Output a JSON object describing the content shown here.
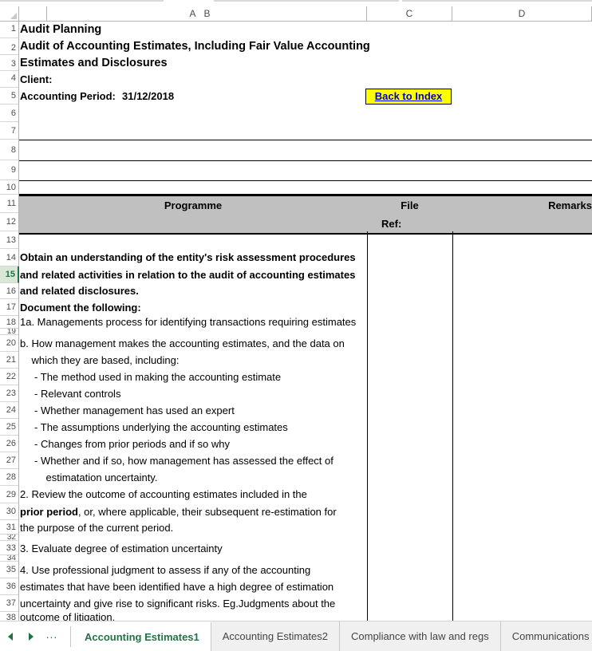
{
  "app": {
    "type": "spreadsheet",
    "columns": [
      "A",
      "B",
      "C",
      "D"
    ],
    "selected_row": 15,
    "accent_color": "#217346",
    "header_fill": "#c0c0c0",
    "hyperlink_fill": "#ffff00",
    "hyperlink_color": "#0000cc"
  },
  "row_numbers": [
    1,
    2,
    3,
    4,
    5,
    6,
    7,
    8,
    9,
    10,
    11,
    12,
    13,
    14,
    15,
    16,
    17,
    18,
    19,
    20,
    21,
    22,
    23,
    24,
    25,
    26,
    27,
    28,
    29,
    30,
    31,
    32,
    33,
    34,
    35,
    36,
    37,
    38
  ],
  "header_block": {
    "line1": "Audit Planning",
    "line2": "Audit of Accounting Estimates, Including Fair Value Accounting",
    "line3": "Estimates and Disclosures",
    "client_label": "Client:",
    "client_value": "",
    "period_label": "Accounting Period:",
    "period_value": "31/12/2018",
    "back_to_index": "Back to Index"
  },
  "table_header": {
    "programme": "Programme",
    "file": "File",
    "ref": "Ref:",
    "remarks": "Remarks"
  },
  "programme_lines": [
    {
      "row": 14,
      "text": "Obtain an understanding of the entity's risk assessment procedures",
      "bold": true
    },
    {
      "row": 15,
      "text": "and related activities in relation to the audit of accounting estimates",
      "bold": true
    },
    {
      "row": 16,
      "text": "and related disclosures.",
      "bold": true
    },
    {
      "row": 17,
      "text": "Document the following:",
      "bold": true
    },
    {
      "row": 18,
      "text": "1a. Managements process for identifying transactions requiring estimates",
      "bold": false
    },
    {
      "row": 20,
      "text": "b. How management makes the accounting estimates, and the data on",
      "bold": false
    },
    {
      "row": 21,
      "text": "    which they are based, including:",
      "bold": false
    },
    {
      "row": 22,
      "text": "     - The method used in making the accounting estimate",
      "bold": false
    },
    {
      "row": 23,
      "text": "     - Relevant controls",
      "bold": false
    },
    {
      "row": 24,
      "text": "     - Whether management has used an expert",
      "bold": false
    },
    {
      "row": 25,
      "text": "     - The assumptions underlying the accounting estimates",
      "bold": false
    },
    {
      "row": 26,
      "text": "     - Changes from prior periods and if so why",
      "bold": false
    },
    {
      "row": 27,
      "text": "     - Whether and if so, how management has assessed the effect of",
      "bold": false
    },
    {
      "row": 28,
      "text": "         estimatation uncertainty.",
      "bold": false
    },
    {
      "row": 29,
      "text": "2. Review the outcome of accounting estimates included in the",
      "bold": false
    },
    {
      "row": 31,
      "text": "the purpose of the current period.",
      "bold": false
    },
    {
      "row": 33,
      "text": "3. Evaluate degree of estimation uncertainty",
      "bold": false
    },
    {
      "row": 35,
      "text": "4. Use professional judgment to assess if any of the accounting",
      "bold": false
    },
    {
      "row": 36,
      "text": "estimates that have been identified have a high degree of estimation",
      "bold": false
    },
    {
      "row": 37,
      "text": "uncertainty and give rise to significant risks. Eg.Judgments about the",
      "bold": false
    },
    {
      "row": 38,
      "text": "outcome of litigation.",
      "bold": false
    }
  ],
  "programme_row30": {
    "bold_part": "prior period",
    "rest_part": ", or, where applicable, their subsequent re-estimation for"
  },
  "tabbar": {
    "nav_first": "previous-sheet",
    "nav_next": "next-sheet",
    "nav_more": "...",
    "tabs": [
      {
        "label": "Accounting Estimates1",
        "active": true
      },
      {
        "label": "Accounting Estimates2",
        "active": false
      },
      {
        "label": "Compliance with law and regs",
        "active": false
      },
      {
        "label": "Communications",
        "active": false
      }
    ]
  }
}
